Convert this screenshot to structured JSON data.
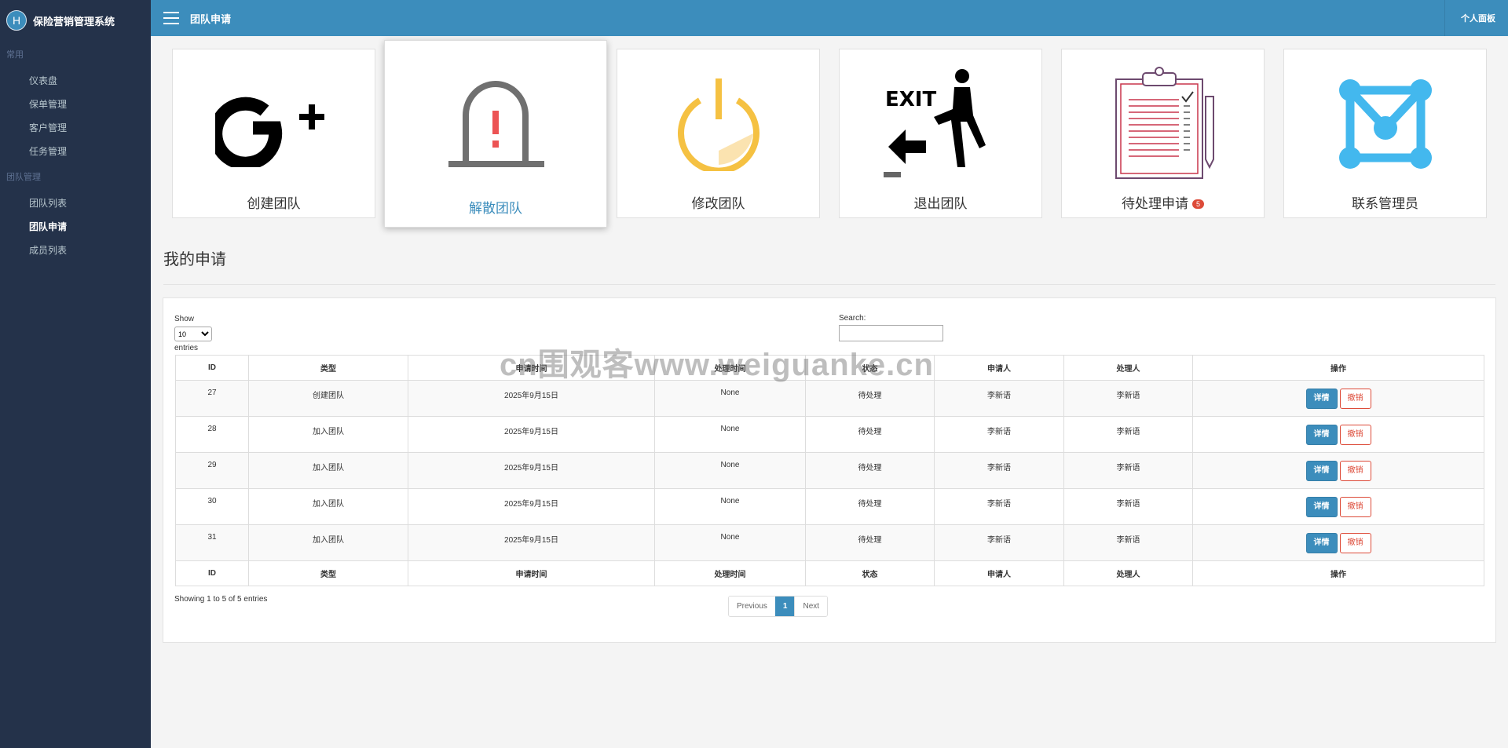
{
  "app": {
    "logo_letter": "H",
    "name": "保险营销管理系统"
  },
  "sidebar": {
    "groups": [
      {
        "label": "常用",
        "items": [
          "仪表盘",
          "保单管理",
          "客户管理",
          "任务管理"
        ]
      },
      {
        "label": "团队管理",
        "items": [
          "团队列表",
          "团队申请",
          "成员列表"
        ]
      }
    ],
    "active_item": "团队申请"
  },
  "header": {
    "title": "团队申请",
    "right_link": "个人面板"
  },
  "cards": [
    {
      "label": "创建团队",
      "icon": "google-plus-icon"
    },
    {
      "label": "解散团队",
      "icon": "alarm-bell-icon",
      "color": "#3c8dbc"
    },
    {
      "label": "修改团队",
      "icon": "power-icon",
      "color": "#f5c142"
    },
    {
      "label": "退出团队",
      "icon": "exit-sign-icon"
    },
    {
      "label": "待处理申请",
      "icon": "clipboard-checklist-icon",
      "badge": "5",
      "badge_color": "#dd4b39"
    },
    {
      "label": "联系管理员",
      "icon": "network-envelope-icon",
      "color": "#43b8ee"
    }
  ],
  "section": {
    "title": "我的申请"
  },
  "datatable": {
    "length_label_before": "Show",
    "length_value": "10",
    "length_label_after": "entries",
    "search_label": "Search:",
    "columns": [
      "ID",
      "类型",
      "申请时间",
      "处理时间",
      "状态",
      "申请人",
      "处理人",
      "操作"
    ],
    "rows": [
      {
        "id": "27",
        "type": "创建团队",
        "applied": "2025年9月15日",
        "processed": "None",
        "status": "待处理",
        "applicant": "李新语",
        "handler": "李新语"
      },
      {
        "id": "28",
        "type": "加入团队",
        "applied": "2025年9月15日",
        "processed": "None",
        "status": "待处理",
        "applicant": "李新语",
        "handler": "李新语"
      },
      {
        "id": "29",
        "type": "加入团队",
        "applied": "2025年9月15日",
        "processed": "None",
        "status": "待处理",
        "applicant": "李新语",
        "handler": "李新语"
      },
      {
        "id": "30",
        "type": "加入团队",
        "applied": "2025年9月15日",
        "processed": "None",
        "status": "待处理",
        "applicant": "李新语",
        "handler": "李新语"
      },
      {
        "id": "31",
        "type": "加入团队",
        "applied": "2025年9月15日",
        "processed": "None",
        "status": "待处理",
        "applicant": "李新语",
        "handler": "李新语"
      }
    ],
    "actions": {
      "detail": "详情",
      "revoke": "撤销"
    },
    "info": "Showing 1 to 5 of 5 entries",
    "pagination": {
      "previous": "Previous",
      "current": "1",
      "next": "Next"
    }
  },
  "watermark": "cn围观客www.weiguanke.cn",
  "colors": {
    "header": "#3c8dbc",
    "sidebar": "#24324a",
    "danger": "#dd4b39"
  }
}
